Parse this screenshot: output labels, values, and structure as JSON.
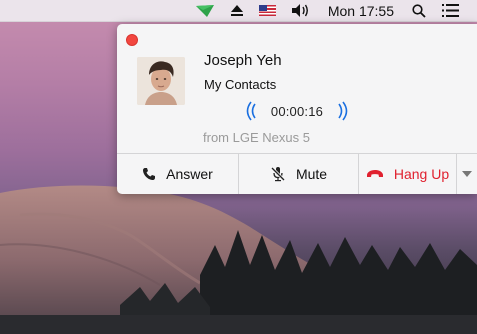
{
  "menubar": {
    "clock": "Mon 17:55",
    "items": [
      "app-icon",
      "eject-icon",
      "us-flag-icon",
      "volume-icon",
      "search-icon",
      "list-icon"
    ]
  },
  "call": {
    "name": "Joseph Yeh",
    "group": "My Contacts",
    "duration": "00:00:16",
    "source": "from LGE Nexus 5"
  },
  "actions": {
    "answer": "Answer",
    "mute": "Mute",
    "hangup": "Hang Up"
  },
  "colors": {
    "hangup": "#e0212f",
    "close": "#f2463f",
    "wave": "#1a6fe0"
  }
}
